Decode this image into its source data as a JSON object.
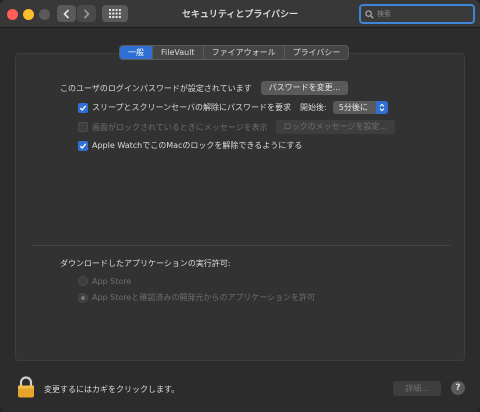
{
  "window": {
    "title": "セキュリティとプライバシー"
  },
  "search": {
    "placeholder": "検索"
  },
  "tabs": [
    {
      "label": "一般",
      "active": true
    },
    {
      "label": "FileVault",
      "active": false
    },
    {
      "label": "ファイアウォール",
      "active": false
    },
    {
      "label": "プライバシー",
      "active": false
    }
  ],
  "general": {
    "password_set_label": "このユーザのログインパスワードが設定されています",
    "change_password_button": "パスワードを変更...",
    "require_password": {
      "label": "スリープとスクリーンセーバの解除にパスワードを要求",
      "checked": true,
      "delay_label": "開始後:",
      "delay_value": "5分後に"
    },
    "show_message": {
      "label": "画面がロックされているときにメッセージを表示",
      "checked": false,
      "disabled": true,
      "button": "ロックのメッセージを設定..."
    },
    "apple_watch": {
      "label": "Apple WatchでこのMacのロックを解除できるようにする",
      "checked": true
    }
  },
  "downloads": {
    "heading": "ダウンロードしたアプリケーションの実行許可:",
    "options": [
      {
        "label": "App Store",
        "selected": false
      },
      {
        "label": "App Storeと確認済みの開発元からのアプリケーションを許可",
        "selected": true
      }
    ]
  },
  "footer": {
    "lock_text": "変更するにはカギをクリックします。",
    "advanced_button": "詳細...",
    "help_label": "?"
  },
  "colors": {
    "accent": "#2f6fd4",
    "close": "#ff5f57",
    "minimize": "#febc2e",
    "lock": "#e6a52a"
  }
}
